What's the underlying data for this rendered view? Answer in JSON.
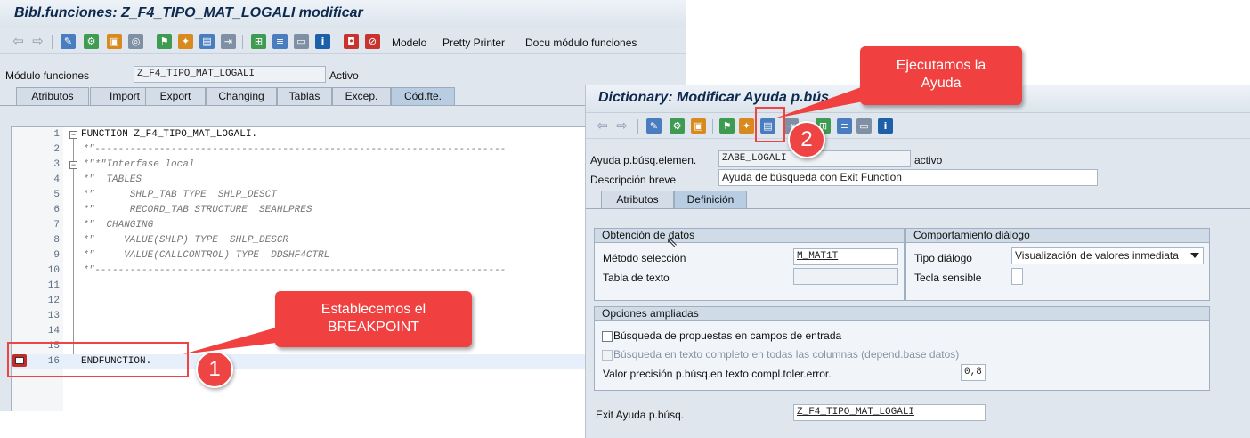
{
  "left_window": {
    "title": "Bibl.funciones: Z_F4_TIPO_MAT_LOGALI modificar",
    "toolbar_text": [
      "Modelo",
      "Pretty Printer",
      "Docu módulo funciones"
    ],
    "module_label": "Módulo funciones",
    "module_value": "Z_F4_TIPO_MAT_LOGALI",
    "status": "Activo",
    "tabs": [
      "Atributos",
      "Import",
      "Export",
      "Changing",
      "Tablas",
      "Excep.",
      "Cód.fte."
    ],
    "code_lines": [
      {
        "num": "1",
        "text": "FUNCTION Z_F4_TIPO_MAT_LOGALI."
      },
      {
        "num": "2",
        "text": "*\"----------------------------------------------------------------------"
      },
      {
        "num": "3",
        "text": "*\"*\"Interfase local"
      },
      {
        "num": "4",
        "text": "*\"  TABLES"
      },
      {
        "num": "5",
        "text": "*\"      SHLP_TAB TYPE  SHLP_DESCT"
      },
      {
        "num": "6",
        "text": "*\"      RECORD_TAB STRUCTURE  SEAHLPRES"
      },
      {
        "num": "7",
        "text": "*\"  CHANGING"
      },
      {
        "num": "8",
        "text": "*\"     VALUE(SHLP) TYPE  SHLP_DESCR"
      },
      {
        "num": "9",
        "text": "*\"     VALUE(CALLCONTROL) TYPE  DDSHF4CTRL"
      },
      {
        "num": "10",
        "text": "*\"----------------------------------------------------------------------"
      },
      {
        "num": "11",
        "text": ""
      },
      {
        "num": "12",
        "text": ""
      },
      {
        "num": "13",
        "text": ""
      },
      {
        "num": "14",
        "text": ""
      },
      {
        "num": "15",
        "text": ""
      },
      {
        "num": "16",
        "text": "ENDFUNCTION."
      }
    ]
  },
  "right_window": {
    "title": "Dictionary: Modificar Ayuda p.bús",
    "help_label": "Ayuda p.búsq.elemen.",
    "help_value": "ZABE_LOGALI",
    "help_status": "activo",
    "desc_label": "Descripción breve",
    "desc_value": "Ayuda de búsqueda con Exit Function",
    "tabs": [
      "Atributos",
      "Definición"
    ],
    "group_obtencion": {
      "title": "Obtención de datos",
      "metodo_label": "Método selección",
      "metodo_value": "M_MAT1T",
      "tabla_label": "Tabla de texto",
      "tabla_value": ""
    },
    "group_comportamiento": {
      "title": "Comportamiento diálogo",
      "tipo_label": "Tipo diálogo",
      "tipo_value": "Visualización de valores inmediata",
      "tecla_label": "Tecla sensible"
    },
    "group_opciones": {
      "title": "Opciones ampliadas",
      "cb1": "Búsqueda de propuestas en campos de entrada",
      "cb2": "Búsqueda en texto completo en todas las columnas (depend.base datos)",
      "valor_label": "Valor precisión p.búsq.en texto compl.toler.error.",
      "valor_value": "0,8"
    },
    "exit_label": "Exit Ayuda p.búsq.",
    "exit_value": "Z_F4_TIPO_MAT_LOGALI"
  },
  "annotations": {
    "callout1_line1": "Establecemos el",
    "callout1_line2": "BREAKPOINT",
    "callout2_line1": "Ejecutamos la",
    "callout2_line2": "Ayuda",
    "badge1": "1",
    "badge2": "2"
  },
  "colors": {
    "accent_red": "#ef4444",
    "title_text": "#0d2a4e",
    "window_bg": "#dfe6ee"
  }
}
